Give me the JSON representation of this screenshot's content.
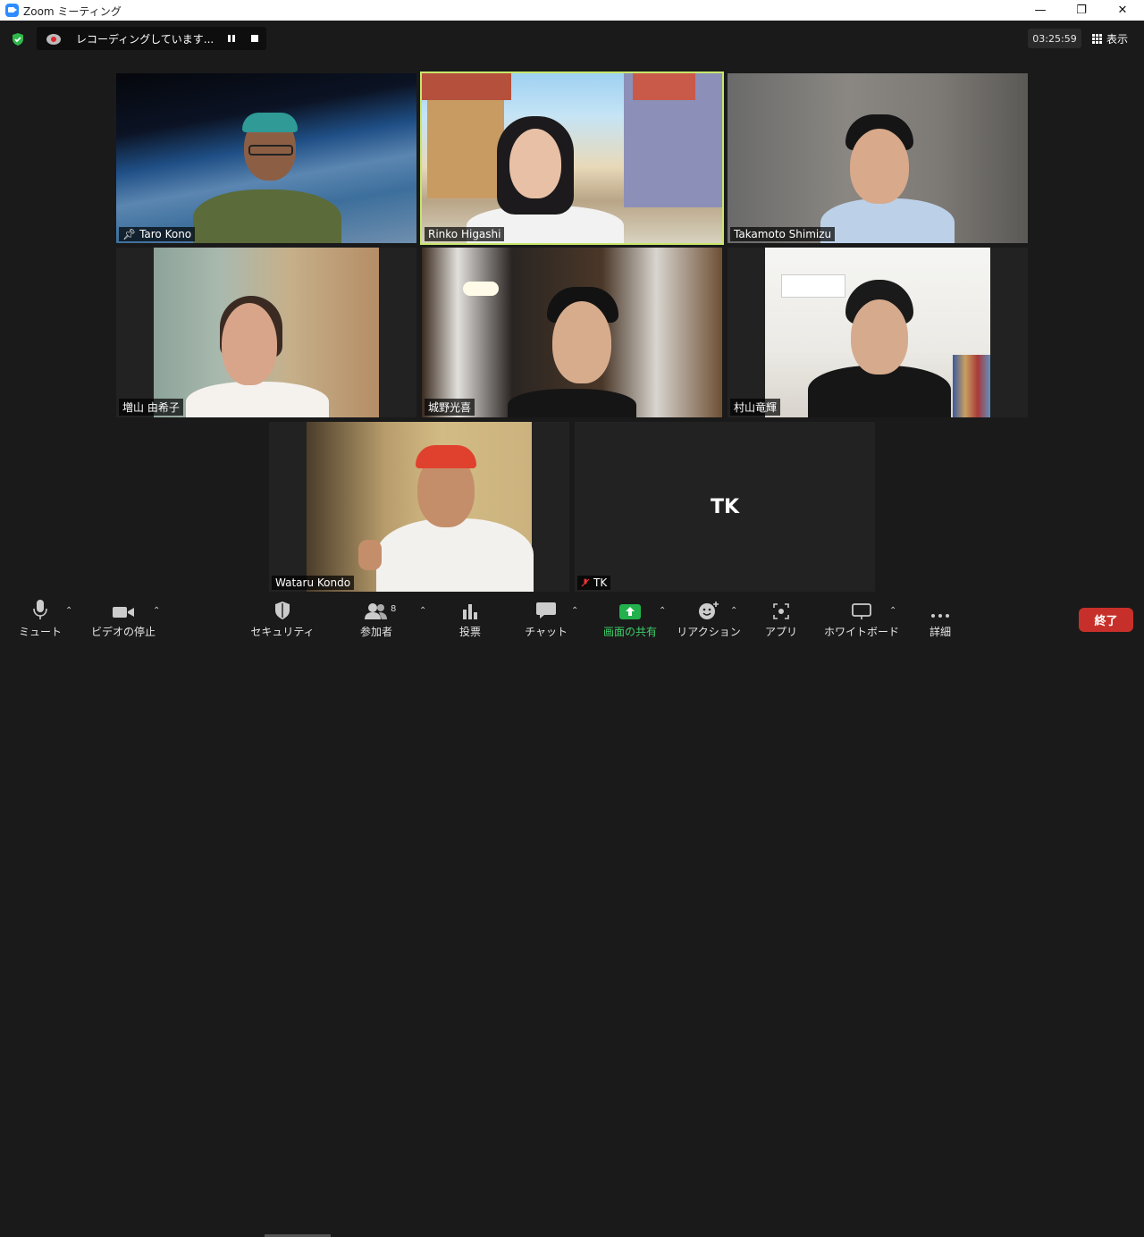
{
  "window": {
    "title": "Zoom ミーティング"
  },
  "recording": {
    "text": "レコーディングしています..."
  },
  "timer": "03:25:59",
  "view_label": "表示",
  "participants": [
    {
      "name": "Taro Kono",
      "pinned": true
    },
    {
      "name": "Rinko Higashi",
      "active": true
    },
    {
      "name": "Takamoto Shimizu"
    },
    {
      "name": "増山 由希子"
    },
    {
      "name": "城野光喜"
    },
    {
      "name": "村山竜輝"
    },
    {
      "name": "Wataru Kondo"
    },
    {
      "name": "TK",
      "initials": "TK",
      "muted": true
    }
  ],
  "toolbar": {
    "mute": "ミュート",
    "video": "ビデオの停止",
    "security": "セキュリティ",
    "participants": "参加者",
    "participants_count": "8",
    "polls": "投票",
    "chat": "チャット",
    "share": "画面の共有",
    "reactions": "リアクション",
    "apps": "アプリ",
    "whiteboard": "ホワイトボード",
    "more": "詳細",
    "end": "終了"
  },
  "colors": {
    "active_border": "#c8e66a",
    "share_green": "#22b14c",
    "end_red": "#c7302a",
    "zoom_blue": "#2d8cff"
  }
}
